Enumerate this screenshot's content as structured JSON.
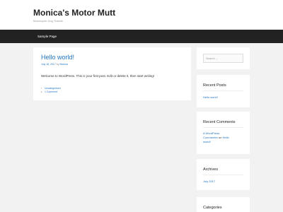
{
  "header": {
    "site_title": "Monica's Motor Mutt",
    "site_description": "Motorcycle Dog Travels"
  },
  "nav": {
    "items": [
      "Sample Page"
    ]
  },
  "post": {
    "title": "Hello world!",
    "meta_date": "July 18, 2017",
    "meta_by": "by",
    "meta_author": "Monica",
    "content": "Welcome to WordPress. This is your first post. Edit or delete it, then start writing!",
    "category": "Uncategorized",
    "comments": "1 Comment"
  },
  "sidebar": {
    "search": {
      "placeholder": "Search ..."
    },
    "recent_posts": {
      "title": "Recent Posts",
      "items": [
        "Hello world!"
      ]
    },
    "recent_comments": {
      "title": "Recent Comments",
      "author_line1": "A WordPress",
      "author_line2": "Commenter",
      "on": "on",
      "post_line1": "Hello",
      "post_line2": "world!"
    },
    "archives": {
      "title": "Archives",
      "items": [
        "July 2017"
      ]
    },
    "categories": {
      "title": "Categories"
    }
  }
}
